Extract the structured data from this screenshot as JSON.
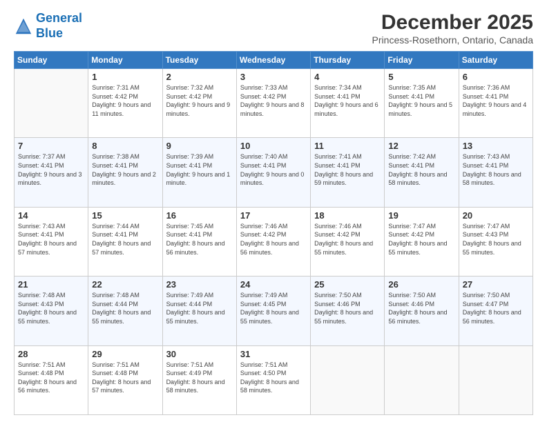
{
  "header": {
    "logo_line1": "General",
    "logo_line2": "Blue",
    "month_title": "December 2025",
    "subtitle": "Princess-Rosethorn, Ontario, Canada"
  },
  "weekdays": [
    "Sunday",
    "Monday",
    "Tuesday",
    "Wednesday",
    "Thursday",
    "Friday",
    "Saturday"
  ],
  "weeks": [
    [
      {
        "day": "",
        "sunrise": "",
        "sunset": "",
        "daylight": ""
      },
      {
        "day": "1",
        "sunrise": "Sunrise: 7:31 AM",
        "sunset": "Sunset: 4:42 PM",
        "daylight": "Daylight: 9 hours and 11 minutes."
      },
      {
        "day": "2",
        "sunrise": "Sunrise: 7:32 AM",
        "sunset": "Sunset: 4:42 PM",
        "daylight": "Daylight: 9 hours and 9 minutes."
      },
      {
        "day": "3",
        "sunrise": "Sunrise: 7:33 AM",
        "sunset": "Sunset: 4:42 PM",
        "daylight": "Daylight: 9 hours and 8 minutes."
      },
      {
        "day": "4",
        "sunrise": "Sunrise: 7:34 AM",
        "sunset": "Sunset: 4:41 PM",
        "daylight": "Daylight: 9 hours and 6 minutes."
      },
      {
        "day": "5",
        "sunrise": "Sunrise: 7:35 AM",
        "sunset": "Sunset: 4:41 PM",
        "daylight": "Daylight: 9 hours and 5 minutes."
      },
      {
        "day": "6",
        "sunrise": "Sunrise: 7:36 AM",
        "sunset": "Sunset: 4:41 PM",
        "daylight": "Daylight: 9 hours and 4 minutes."
      }
    ],
    [
      {
        "day": "7",
        "sunrise": "Sunrise: 7:37 AM",
        "sunset": "Sunset: 4:41 PM",
        "daylight": "Daylight: 9 hours and 3 minutes."
      },
      {
        "day": "8",
        "sunrise": "Sunrise: 7:38 AM",
        "sunset": "Sunset: 4:41 PM",
        "daylight": "Daylight: 9 hours and 2 minutes."
      },
      {
        "day": "9",
        "sunrise": "Sunrise: 7:39 AM",
        "sunset": "Sunset: 4:41 PM",
        "daylight": "Daylight: 9 hours and 1 minute."
      },
      {
        "day": "10",
        "sunrise": "Sunrise: 7:40 AM",
        "sunset": "Sunset: 4:41 PM",
        "daylight": "Daylight: 9 hours and 0 minutes."
      },
      {
        "day": "11",
        "sunrise": "Sunrise: 7:41 AM",
        "sunset": "Sunset: 4:41 PM",
        "daylight": "Daylight: 8 hours and 59 minutes."
      },
      {
        "day": "12",
        "sunrise": "Sunrise: 7:42 AM",
        "sunset": "Sunset: 4:41 PM",
        "daylight": "Daylight: 8 hours and 58 minutes."
      },
      {
        "day": "13",
        "sunrise": "Sunrise: 7:43 AM",
        "sunset": "Sunset: 4:41 PM",
        "daylight": "Daylight: 8 hours and 58 minutes."
      }
    ],
    [
      {
        "day": "14",
        "sunrise": "Sunrise: 7:43 AM",
        "sunset": "Sunset: 4:41 PM",
        "daylight": "Daylight: 8 hours and 57 minutes."
      },
      {
        "day": "15",
        "sunrise": "Sunrise: 7:44 AM",
        "sunset": "Sunset: 4:41 PM",
        "daylight": "Daylight: 8 hours and 57 minutes."
      },
      {
        "day": "16",
        "sunrise": "Sunrise: 7:45 AM",
        "sunset": "Sunset: 4:41 PM",
        "daylight": "Daylight: 8 hours and 56 minutes."
      },
      {
        "day": "17",
        "sunrise": "Sunrise: 7:46 AM",
        "sunset": "Sunset: 4:42 PM",
        "daylight": "Daylight: 8 hours and 56 minutes."
      },
      {
        "day": "18",
        "sunrise": "Sunrise: 7:46 AM",
        "sunset": "Sunset: 4:42 PM",
        "daylight": "Daylight: 8 hours and 55 minutes."
      },
      {
        "day": "19",
        "sunrise": "Sunrise: 7:47 AM",
        "sunset": "Sunset: 4:42 PM",
        "daylight": "Daylight: 8 hours and 55 minutes."
      },
      {
        "day": "20",
        "sunrise": "Sunrise: 7:47 AM",
        "sunset": "Sunset: 4:43 PM",
        "daylight": "Daylight: 8 hours and 55 minutes."
      }
    ],
    [
      {
        "day": "21",
        "sunrise": "Sunrise: 7:48 AM",
        "sunset": "Sunset: 4:43 PM",
        "daylight": "Daylight: 8 hours and 55 minutes."
      },
      {
        "day": "22",
        "sunrise": "Sunrise: 7:48 AM",
        "sunset": "Sunset: 4:44 PM",
        "daylight": "Daylight: 8 hours and 55 minutes."
      },
      {
        "day": "23",
        "sunrise": "Sunrise: 7:49 AM",
        "sunset": "Sunset: 4:44 PM",
        "daylight": "Daylight: 8 hours and 55 minutes."
      },
      {
        "day": "24",
        "sunrise": "Sunrise: 7:49 AM",
        "sunset": "Sunset: 4:45 PM",
        "daylight": "Daylight: 8 hours and 55 minutes."
      },
      {
        "day": "25",
        "sunrise": "Sunrise: 7:50 AM",
        "sunset": "Sunset: 4:46 PM",
        "daylight": "Daylight: 8 hours and 55 minutes."
      },
      {
        "day": "26",
        "sunrise": "Sunrise: 7:50 AM",
        "sunset": "Sunset: 4:46 PM",
        "daylight": "Daylight: 8 hours and 56 minutes."
      },
      {
        "day": "27",
        "sunrise": "Sunrise: 7:50 AM",
        "sunset": "Sunset: 4:47 PM",
        "daylight": "Daylight: 8 hours and 56 minutes."
      }
    ],
    [
      {
        "day": "28",
        "sunrise": "Sunrise: 7:51 AM",
        "sunset": "Sunset: 4:48 PM",
        "daylight": "Daylight: 8 hours and 56 minutes."
      },
      {
        "day": "29",
        "sunrise": "Sunrise: 7:51 AM",
        "sunset": "Sunset: 4:48 PM",
        "daylight": "Daylight: 8 hours and 57 minutes."
      },
      {
        "day": "30",
        "sunrise": "Sunrise: 7:51 AM",
        "sunset": "Sunset: 4:49 PM",
        "daylight": "Daylight: 8 hours and 58 minutes."
      },
      {
        "day": "31",
        "sunrise": "Sunrise: 7:51 AM",
        "sunset": "Sunset: 4:50 PM",
        "daylight": "Daylight: 8 hours and 58 minutes."
      },
      {
        "day": "",
        "sunrise": "",
        "sunset": "",
        "daylight": ""
      },
      {
        "day": "",
        "sunrise": "",
        "sunset": "",
        "daylight": ""
      },
      {
        "day": "",
        "sunrise": "",
        "sunset": "",
        "daylight": ""
      }
    ]
  ]
}
